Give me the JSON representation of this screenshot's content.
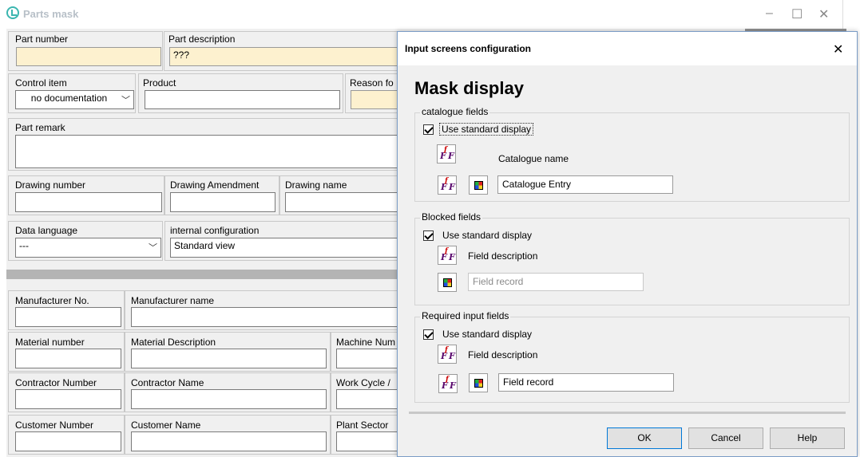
{
  "window": {
    "title": "Parts mask",
    "controls": [
      "–",
      "☐",
      "✕"
    ]
  },
  "form": {
    "part_number": {
      "label": "Part number",
      "value": ""
    },
    "part_description": {
      "label": "Part description",
      "value": "???"
    },
    "control_item": {
      "label": "Control item",
      "value": "no documentation"
    },
    "product": {
      "label": "Product",
      "value": ""
    },
    "reason": {
      "label": "Reason fo",
      "value": ""
    },
    "part_remark": {
      "label": "Part remark",
      "value": ""
    },
    "drawing_number": {
      "label": "Drawing number",
      "value": ""
    },
    "drawing_amendment": {
      "label": "Drawing Amendment",
      "value": ""
    },
    "drawing_name": {
      "label": "Drawing name",
      "value": ""
    },
    "data_language": {
      "label": "Data language",
      "value": "---"
    },
    "internal_configuration": {
      "label": "internal configuration",
      "value": "Standard view"
    },
    "manufacturer_no": {
      "label": "Manufacturer No.",
      "value": ""
    },
    "manufacturer_name": {
      "label": "Manufacturer name",
      "value": ""
    },
    "material_number": {
      "label": "Material number",
      "value": ""
    },
    "material_description": {
      "label": "Material Description",
      "value": ""
    },
    "machine_num": {
      "label": "Machine Num",
      "value": ""
    },
    "contractor_number": {
      "label": "Contractor Number",
      "value": ""
    },
    "contractor_name": {
      "label": "Contractor Name",
      "value": ""
    },
    "work_cycle": {
      "label": "Work Cycle /",
      "value": ""
    },
    "customer_number": {
      "label": "Customer Number",
      "value": ""
    },
    "customer_name": {
      "label": "Customer Name",
      "value": ""
    },
    "plant_sector": {
      "label": "Plant Sector",
      "value": ""
    }
  },
  "dialog": {
    "title": "Input screens configuration",
    "close": "✕",
    "heading": "Mask display",
    "groups": {
      "catalogue": {
        "title": "catalogue fields",
        "checkbox_label": "Use standard display",
        "checked": true,
        "name_label": "Catalogue name",
        "entry_value": "Catalogue Entry"
      },
      "blocked": {
        "title": "Blocked fields",
        "checkbox_label": "Use standard display",
        "checked": true,
        "desc_label": "Field description",
        "record_value": "Field record"
      },
      "required": {
        "title": "Required input fields",
        "checkbox_label": "Use standard display",
        "checked": true,
        "desc_label": "Field description",
        "record_value": "Field record"
      }
    },
    "buttons": {
      "ok": "OK",
      "cancel": "Cancel",
      "help": "Help"
    }
  },
  "colors": {
    "required_field_bg": "#fdf1cf",
    "accent_teal": "#3bb6b0",
    "default_button_border": "#0078d7"
  }
}
